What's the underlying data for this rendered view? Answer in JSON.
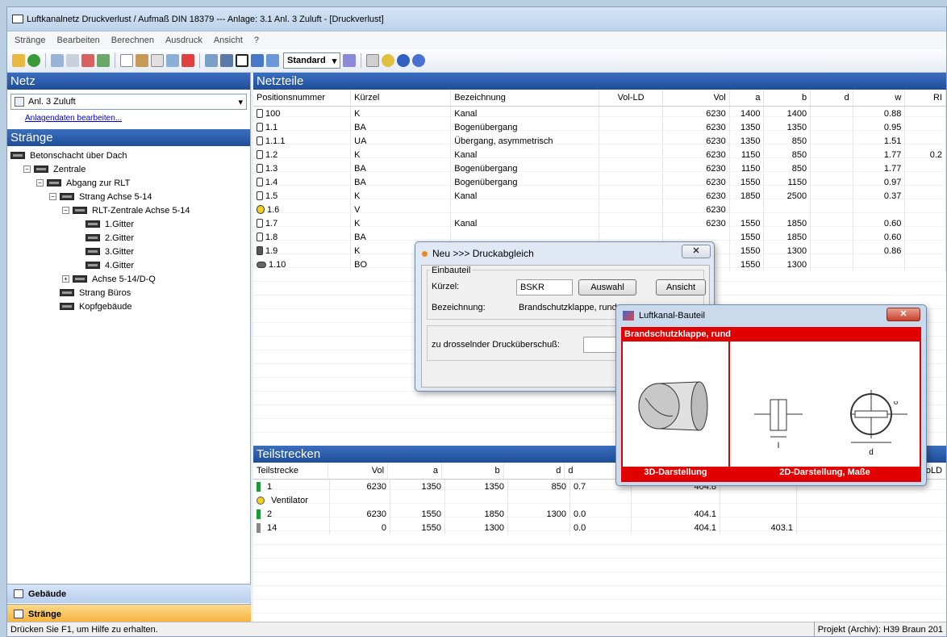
{
  "title": "Luftkanalnetz Druckverlust / Aufmaß DIN 18379 --- Anlage: 3.1 Anl. 3  Zuluft - [Druckverlust]",
  "menu": [
    "Stränge",
    "Bearbeiten",
    "Berechnen",
    "Ausdruck",
    "Ansicht",
    "?"
  ],
  "toolbar": {
    "select": "Standard"
  },
  "netz": {
    "header": "Netz",
    "selected": "Anl. 3 Zuluft",
    "link": "Anlagendaten bearbeiten..."
  },
  "straenge": {
    "header": "Stränge",
    "tree": [
      {
        "label": "Betonschacht über Dach",
        "level": 0
      },
      {
        "label": "Zentrale",
        "level": 1
      },
      {
        "label": "Abgang zur RLT",
        "level": 2
      },
      {
        "label": "Strang Achse 5-14",
        "level": 3
      },
      {
        "label": "RLT-Zentrale Achse 5-14",
        "level": 4
      },
      {
        "label": "1.Gitter",
        "level": 5
      },
      {
        "label": "2.Gitter",
        "level": 5
      },
      {
        "label": "3.Gitter",
        "level": 5
      },
      {
        "label": "4.Gitter",
        "level": 5
      },
      {
        "label": "Achse 5-14/D-Q",
        "level": 4
      },
      {
        "label": "Strang Büros",
        "level": 3
      },
      {
        "label": "Kopfgebäude",
        "level": 3
      }
    ]
  },
  "nav": {
    "gebaeude": "Gebäude",
    "straenge": "Stränge"
  },
  "netzteile": {
    "header": "Netzteile",
    "columns": [
      "Positionsnummer",
      "Kürzel",
      "Bezeichnung",
      "Vol-LD",
      "Vol",
      "a",
      "b",
      "d",
      "w",
      "RI"
    ],
    "rows": [
      [
        "100",
        "K",
        "Kanal",
        "",
        "6230",
        "1400",
        "1400",
        "",
        "0.88",
        ""
      ],
      [
        "1.1",
        "BA",
        "Bogenübergang",
        "",
        "6230",
        "1350",
        "1350",
        "",
        "0.95",
        ""
      ],
      [
        "1.1.1",
        "UA",
        "Übergang, asymmetrisch",
        "",
        "6230",
        "1350",
        "850",
        "",
        "1.51",
        ""
      ],
      [
        "1.2",
        "K",
        "Kanal",
        "",
        "6230",
        "1150",
        "850",
        "",
        "1.77",
        "0.2"
      ],
      [
        "1.3",
        "BA",
        "Bogenübergang",
        "",
        "6230",
        "1150",
        "850",
        "",
        "1.77",
        ""
      ],
      [
        "1.4",
        "BA",
        "Bogenübergang",
        "",
        "6230",
        "1550",
        "1150",
        "",
        "0.97",
        ""
      ],
      [
        "1.5",
        "K",
        "Kanal",
        "",
        "6230",
        "1850",
        "2500",
        "",
        "0.37",
        ""
      ],
      [
        "1.6",
        "V",
        "",
        "",
        "6230",
        "",
        "",
        "",
        "",
        ""
      ],
      [
        "1.7",
        "K",
        "Kanal",
        "",
        "6230",
        "1550",
        "1850",
        "",
        "0.60",
        ""
      ],
      [
        "1.8",
        "BA",
        "",
        "",
        "",
        "1550",
        "1850",
        "",
        "0.60",
        ""
      ],
      [
        "1.9",
        "K",
        "",
        "",
        "",
        "1550",
        "1300",
        "",
        "0.86",
        ""
      ],
      [
        "1.10",
        "BO",
        "",
        "",
        "",
        "1550",
        "1300",
        "",
        "",
        ""
      ]
    ]
  },
  "teilstrecken": {
    "header": "Teilstrecken",
    "columns": [
      "Teilstrecke",
      "Vol",
      "a",
      "b",
      "d",
      "d",
      "",
      "",
      "",
      "roLD"
    ],
    "rows": [
      [
        "1",
        "6230",
        "1350",
        "1350",
        "850",
        "0.7",
        "404.8",
        ""
      ],
      [
        "Ventilator",
        "",
        "",
        "",
        "",
        "",
        "",
        ""
      ],
      [
        "2",
        "6230",
        "1550",
        "1850",
        "1300",
        "0.0",
        "404.1",
        ""
      ],
      [
        "14",
        "0",
        "1550",
        "1300",
        "",
        "0.0",
        "404.1",
        "403.1"
      ]
    ]
  },
  "druckabgleich": {
    "title": "Neu >>> Druckabgleich",
    "group": "Einbauteil",
    "kuerzel_label": "Kürzel:",
    "kuerzel": "BSKR",
    "auswahl": "Auswahl",
    "ansicht": "Ansicht",
    "bez_label": "Bezeichnung:",
    "bez": "Brandschutzklappe, rund",
    "drossel_label": "zu drosselnder Drucküberschuß:"
  },
  "bauteil": {
    "title": "Luftkanal-Bauteil",
    "name": "Brandschutzklappe, rund",
    "d3": "3D-Darstellung",
    "d2": "2D-Darstellung, Maße",
    "dim_l": "l",
    "dim_d": "d",
    "dim_c": "c"
  },
  "status": {
    "left": "Drücken Sie F1, um Hilfe zu erhalten.",
    "right": "Projekt (Archiv): H39 Braun 201"
  }
}
